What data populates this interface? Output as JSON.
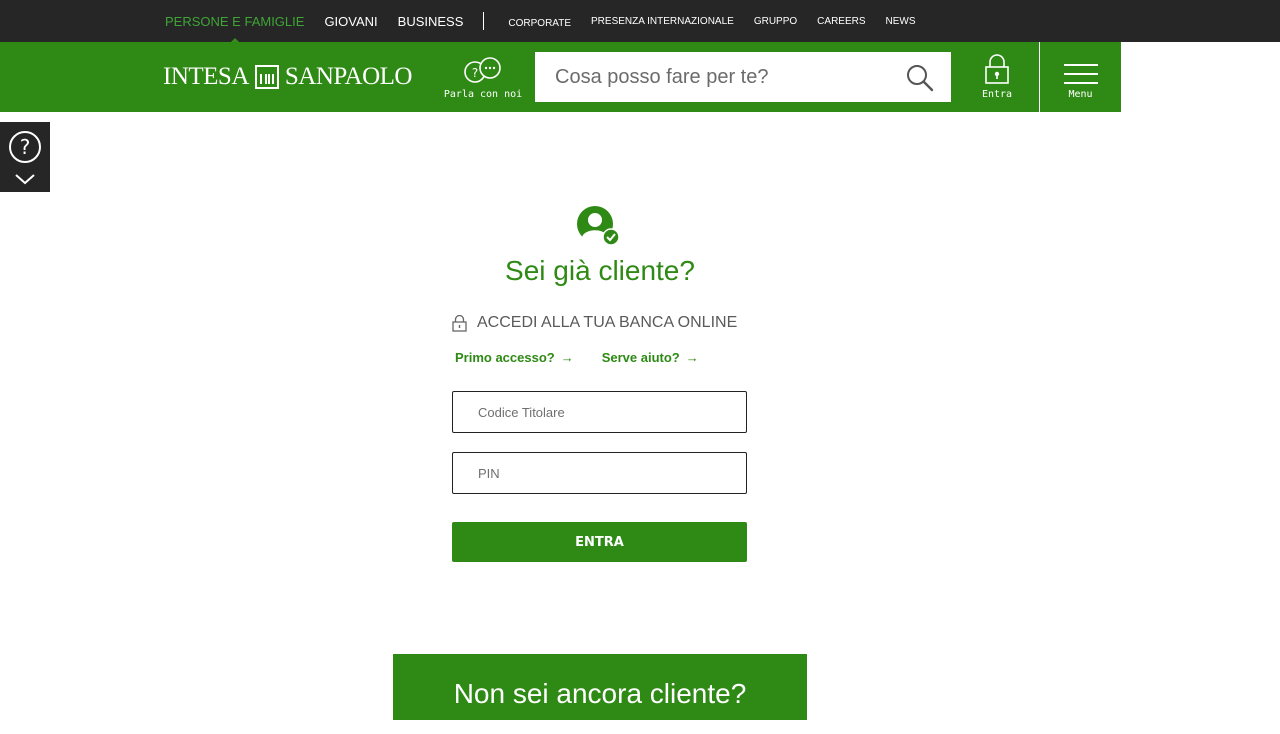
{
  "topnav": {
    "segments": [
      "PERSONE E FAMIGLIE",
      "GIOVANI",
      "BUSINESS"
    ],
    "links": [
      "CORPORATE",
      "PRESENZA INTERNAZIONALE",
      "GRUPPO",
      "CAREERS",
      "NEWS"
    ]
  },
  "header": {
    "logo_left": "INTESA",
    "logo_right": "SANPAOLO",
    "parla_label": "Parla con noi",
    "search_placeholder": "Cosa posso fare per te?",
    "entra_label": "Entra",
    "menu_label": "Menu"
  },
  "login": {
    "title": "Sei già cliente?",
    "accedi": "ACCEDI ALLA TUA BANCA ONLINE",
    "primo_accesso": "Primo accesso?",
    "serve_aiuto": "Serve aiuto?",
    "codice_placeholder": "Codice Titolare",
    "pin_placeholder": "PIN",
    "submit_label": "ENTRA"
  },
  "promo": {
    "title": "Non sei ancora cliente?"
  },
  "colors": {
    "brand_green": "#2e8a14",
    "topbar": "#262626",
    "active_nav": "#3fa535"
  },
  "icons": [
    "chat-icon",
    "search-icon",
    "lock-icon",
    "hamburger-icon",
    "help-icon",
    "chevron-down-icon",
    "user-check-icon",
    "arrow-right-icon"
  ]
}
